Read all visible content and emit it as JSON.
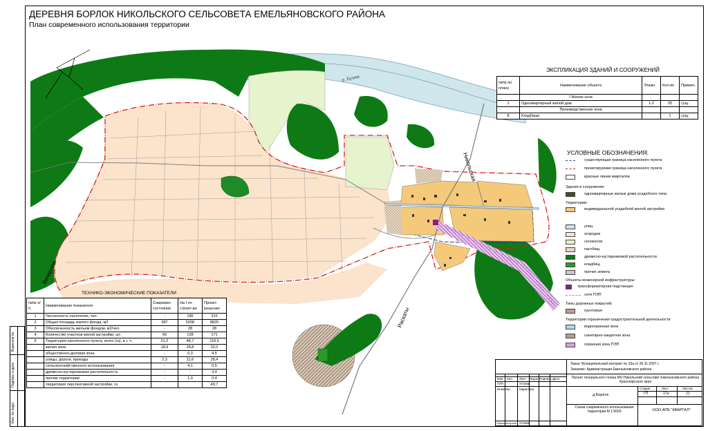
{
  "title": "ДЕРЕВНЯ БОРЛОК НИКОЛЬСКОГО СЕЛЬСОВЕТА ЕМЕЛЬЯНОВСКОГО РАЙОНА",
  "subtitle": "План современного использования территории",
  "map_labels": {
    "river": "р. Бузим",
    "street_nikolskaya": "Никольская",
    "street_vechernyaya": "Вечерняя",
    "street_raskaty": "Раскаты"
  },
  "explication": {
    "title": "ЭКСПЛИКАЦИЯ ЗДАНИЙ И СООРУЖЕНИЙ",
    "headers": [
      "№№ по плану",
      "Наименование объекта",
      "Этажн.",
      "Кол-во",
      "Примеч."
    ],
    "sections": [
      {
        "heading": "I Жилая зона",
        "rows": [
          [
            "1",
            "Одноквартирный жилой дом",
            "1-2",
            "25",
            "сущ."
          ]
        ]
      },
      {
        "heading": "Производственная зона",
        "rows": [
          [
            "8",
            "Кладбище",
            "",
            "1",
            "сущ."
          ]
        ]
      }
    ]
  },
  "legend": {
    "title": "УСЛОВНЫЕ ОБОЗНАЧЕНИЯ:",
    "lines": [
      {
        "label": "существующая граница населенного пункта",
        "color": "#2a3a9a"
      },
      {
        "label": "проектируемая граница населенного пункта",
        "color": "#d22020"
      },
      {
        "label": "красные линии кварталов",
        "color": "#888888"
      }
    ],
    "buildings_heading": "Здания и сооружения:",
    "buildings": [
      {
        "label": "одноквартирные жилые дома усадебного типа",
        "color": "#4a4a2a"
      }
    ],
    "territories_heading": "Территории:",
    "territories": [
      {
        "label": "индивидуальной усадебной жилой застройки",
        "color": "#f5c97a"
      },
      {
        "label": "улиц",
        "color": "#d0e4ec"
      },
      {
        "label": "огородов",
        "color": "#fbe3cc"
      },
      {
        "label": "сенокосов",
        "color": "#e6f3cc"
      },
      {
        "label": "пастбищ",
        "color": "#e8d7c2"
      },
      {
        "label": "древесно-кустарниковой растительности",
        "color": "#0e7a16"
      },
      {
        "label": "кладбищ",
        "color": "#2a9a2a"
      },
      {
        "label": "прочих земель",
        "color": "#c8c8c8"
      }
    ],
    "engineering_heading": "Объекты инженерной инфраструктуры:",
    "engineering": [
      {
        "label": "трансформаторная подстанция",
        "color": "#8a1a9a"
      },
      {
        "label": "сети ПЭП",
        "color": "#b080c0"
      }
    ],
    "roads_heading": "Типы дорожных покрытий:",
    "roads": [
      {
        "label": "грунтовые",
        "color": "#c49a9a"
      }
    ],
    "restrictions_heading": "Территории ограничения градостроительной деятельности",
    "restrictions": [
      {
        "label": "водоохранная зона",
        "color": "#a8d8e8"
      },
      {
        "label": "санитарно-защитная зона",
        "color": "#b0a090"
      },
      {
        "label": "охранная зона ПЭП",
        "color": "#d8a0e0"
      }
    ]
  },
  "tech": {
    "title": "ТЕХНИКО-ЭКОНОМИЧЕСКИЕ ПОКАЗАТЕЛИ",
    "headers": [
      "№№ п/п",
      "Наименование показателя",
      "Современ состояние",
      "На I оч. строит-ва",
      "Проект. решение"
    ],
    "rows": [
      [
        "1",
        "Численность населения, чел.",
        "-",
        "186",
        "315"
      ],
      [
        "2",
        "Общая площадь жилого фонда, м2",
        "387",
        "5208",
        "8820"
      ],
      [
        "3",
        "Обеспеченность жильем фондом, м2/чел.",
        "-",
        "28",
        "28"
      ],
      [
        "4",
        "Количество участков жилой застройки, шт.",
        "66",
        "128",
        "171"
      ],
      [
        "5",
        "Территория населенного пункта, всего (га), в т. ч.",
        "21,2",
        "48,7",
        "118,9"
      ],
      [
        "",
        "жилая зона",
        "18,9",
        "28,8",
        "32,0"
      ],
      [
        "",
        "общественно-деловая зона",
        "-",
        "0,3",
        "4,5"
      ],
      [
        "",
        "улицы, дороги, проезды",
        "2,3",
        "11,6",
        "28,4"
      ],
      [
        "",
        "сельскохозяйственного использования",
        "-",
        "4,1",
        "0,5"
      ],
      [
        "",
        "древесно-кустарниковая растительность",
        "-",
        "-",
        "3,4"
      ],
      [
        "",
        "прочие территории",
        "-",
        "1,0",
        "0,4"
      ],
      [
        "",
        "территория перспективной застройки, га",
        "",
        "",
        "49,7"
      ]
    ]
  },
  "stamp": {
    "order": "Заказ: Муниципальный контракт № 33а от 26.11.2007 г.",
    "customer": "Заказчик: Администрация Емельяновского района",
    "heads": [
      "Изм.",
      "Кол.",
      "Лист",
      "№док",
      "Подпись",
      "Дата"
    ],
    "project": "Проект генерального плана МО Никольский сельсовет Емельяновского района Красноярского края",
    "gip": "ГИП",
    "gip_name": "Углова",
    "engineer": "Инженер",
    "engineer_name": "Марипова",
    "village": "д.Борлок",
    "stage_h": "Стадия",
    "sheet_h": "Лист",
    "sheets_h": "Листов",
    "stage": "ГП",
    "sheet": "17а",
    "sheets": "21",
    "scheme": "Схема современного использования территории М 1:5000",
    "org": "ООО АПБ \"КВАРТАЛ\"",
    "normcontrol": "Нормоконтроль",
    "norm_name": "Углова"
  },
  "side_stamp": [
    "Взам.инв.№",
    "Подпись и дата",
    "Инв. № подл."
  ]
}
